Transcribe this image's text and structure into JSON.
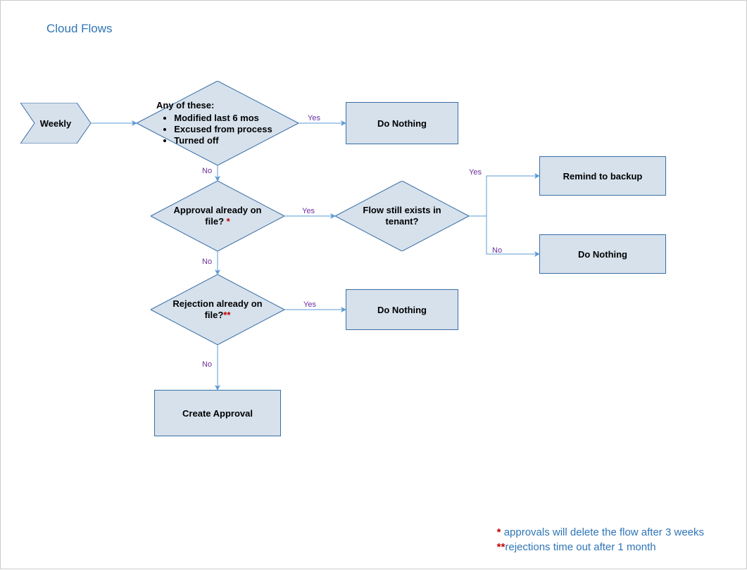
{
  "title": "Cloud Flows",
  "start": {
    "label": "Weekly"
  },
  "decisions": {
    "d1": {
      "header": "Any of these:",
      "bullets": [
        "Modified last 6 mos",
        "Excused from process",
        "Turned off"
      ]
    },
    "d2": {
      "text": "Approval already on file? ",
      "note": "*"
    },
    "d3": {
      "text": "Flow still exists in tenant?"
    },
    "d4": {
      "text": "Rejection already on file?",
      "note": "**"
    }
  },
  "processes": {
    "p1": "Do Nothing",
    "p2": "Remind to backup",
    "p3": "Do Nothing",
    "p4": "Do Nothing",
    "p5": "Create Approval"
  },
  "edges": {
    "yes": "Yes",
    "no": "No"
  },
  "footnotes": {
    "l1a": "* ",
    "l1b": "approvals will delete the flow after 3 weeks",
    "l2a": "**",
    "l2b": "rejections time out after 1 month"
  },
  "colors": {
    "shapeFill": "#d6e1ec",
    "shapeStroke": "#3a6ea5",
    "arrow": "#5b9bd5",
    "edgeLabel": "#6a2e9c",
    "title": "#2e75b6",
    "red": "#c00000"
  }
}
